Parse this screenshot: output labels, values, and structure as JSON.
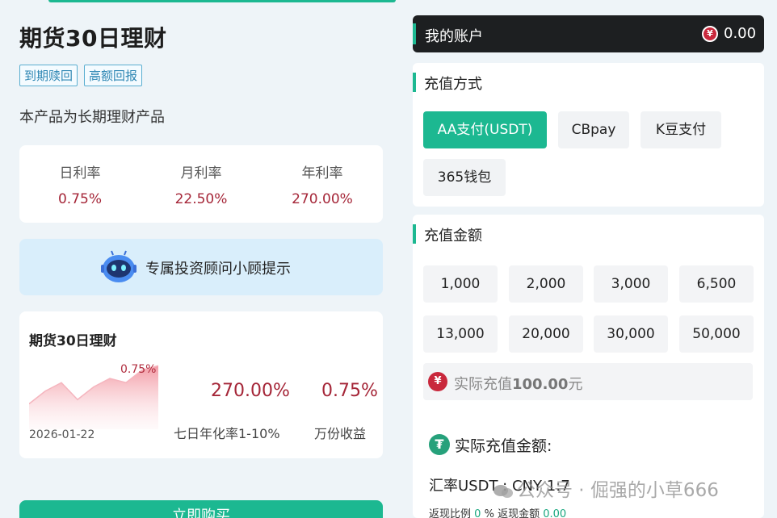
{
  "product": {
    "title": "期货30日理财",
    "tags": [
      "到期赎回",
      "高额回报"
    ],
    "description": "本产品为长期理财产品",
    "rates": [
      {
        "label": "日利率",
        "value": "0.75%"
      },
      {
        "label": "月利率",
        "value": "22.50%"
      },
      {
        "label": "年利率",
        "value": "270.00%"
      }
    ],
    "advisor_text": "专属投资顾问小顾提示",
    "card": {
      "title": "期货30日理财",
      "spark_label": "0.75%",
      "date": "2026-01-22",
      "spark_values": [
        0.3,
        0.45,
        0.55,
        0.35,
        0.5,
        0.6,
        0.55,
        0.7,
        0.75
      ],
      "annual_rate": "270.00%",
      "annual_label": "七日年化率1-10%",
      "yield_rate": "0.75%",
      "yield_label": "万份收益"
    },
    "cta_label": "立即购买"
  },
  "account": {
    "title": "我的账户",
    "currency_symbol": "¥",
    "balance": "0.00"
  },
  "payment": {
    "title": "充值方式",
    "methods": [
      "AA支付(USDT)",
      "CBpay",
      "K豆支付",
      "365钱包"
    ],
    "selected": "AA支付(USDT)"
  },
  "amount": {
    "title": "充值金额",
    "options": [
      "1,000",
      "2,000",
      "3,000",
      "6,500",
      "13,000",
      "20,000",
      "30,000",
      "50,000"
    ],
    "actual_prefix": "实际充值",
    "actual_value": "100.00",
    "actual_suffix": "元",
    "usdt_icon": "₮",
    "usdt_label": "实际充值金额:",
    "rate_line": "汇率USDT : CNY 1:7",
    "rebate_ratio_label": "返现比例",
    "rebate_ratio": "0",
    "rebate_ratio_unit": "%",
    "rebate_amount_label": "返现金额",
    "rebate_amount": "0.00"
  },
  "watermark": "公众号 · 倔强的小草666",
  "colors": {
    "accent": "#1cb891",
    "rate_red": "#a52638",
    "dark": "#1d1f21"
  }
}
